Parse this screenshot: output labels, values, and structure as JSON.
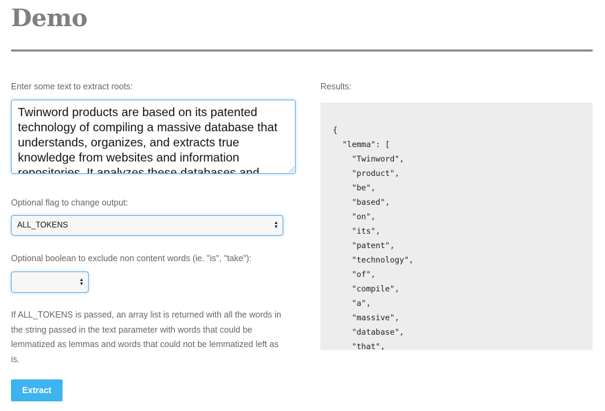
{
  "page": {
    "title": "Demo"
  },
  "form": {
    "text_label": "Enter some text to extract roots:",
    "text_value": "Twinword products are based on its patented technology of compiling a massive database that understands, organizes, and extracts true knowledge from websites and information repositories. It analyzes these databases and",
    "flag_label": "Optional flag to change output:",
    "flag_selected": "ALL_TOKENS",
    "bool_label": "Optional boolean to exclude non content words (ie. \"is\", \"take\"):",
    "bool_selected": "",
    "help_text": "If ALL_TOKENS is passed, an array list is returned with all the words in the string passed in the text parameter with words that could be lemmatized as lemmas and words that could not be lemmatized left as is.",
    "extract_label": "Extract"
  },
  "results": {
    "label": "Results:",
    "json_text": "{\n  \"lemma\": [\n    \"Twinword\",\n    \"product\",\n    \"be\",\n    \"based\",\n    \"on\",\n    \"its\",\n    \"patent\",\n    \"technology\",\n    \"of\",\n    \"compile\",\n    \"a\",\n    \"massive\",\n    \"database\",\n    \"that\","
  },
  "colors": {
    "accent": "#3db4f0",
    "focus_border": "#66afe9",
    "title": "#7f7f7f",
    "results_bg": "#ededed"
  }
}
